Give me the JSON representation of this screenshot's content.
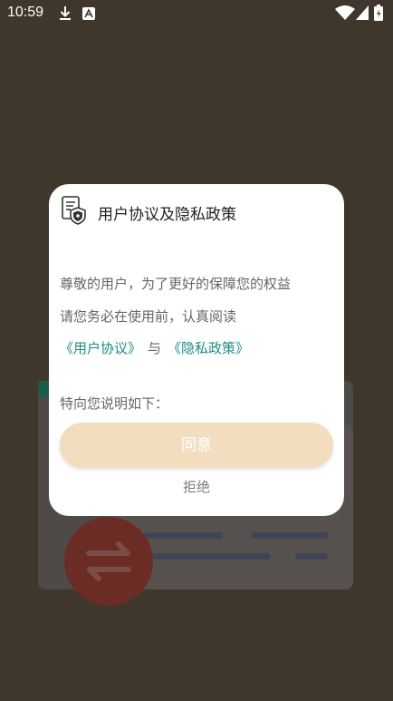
{
  "status_bar": {
    "time": "10:59",
    "icons": [
      "download-icon",
      "accessibility-icon",
      "wifi-icon",
      "signal-icon",
      "battery-icon"
    ]
  },
  "dialog": {
    "title": "用户协议及隐私政策",
    "icon": "document-shield-icon",
    "body_line1": "尊敬的用户，为了更好的保障您的权益",
    "body_line2": "请您务必在使用前，认真阅读",
    "user_agreement_link": "《用户协议》",
    "and_text": "与",
    "privacy_policy_link": "《隐私政策》",
    "intro_text": "特向您说明如下：",
    "agree_label": "同意",
    "reject_label": "拒绝"
  },
  "colors": {
    "backdrop": "#40372c",
    "link": "#1a8e82",
    "agree_button": "#f3ddbf",
    "dialog_background": "#ffffff"
  }
}
